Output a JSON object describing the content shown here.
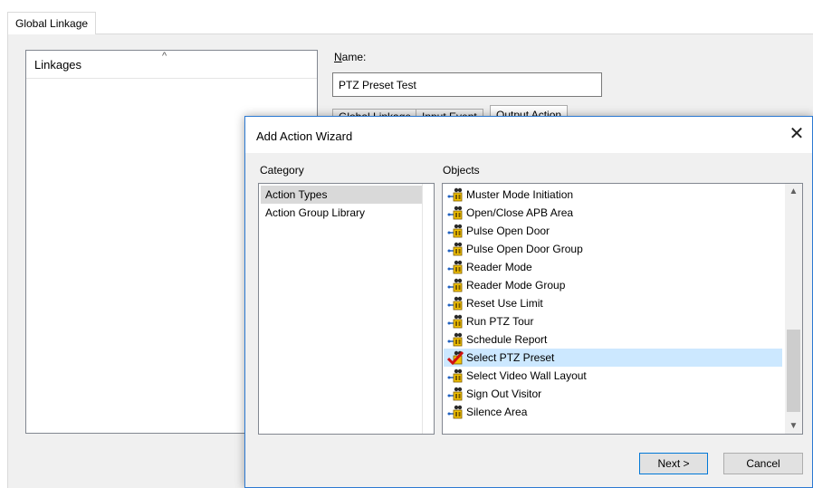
{
  "window": {
    "tab_label": "Global Linkage",
    "linkages_header": "Linkages",
    "sort_arrow": "^",
    "name_label_mnemonic": "N",
    "name_label_rest": "ame:",
    "name_value": "PTZ Preset Test",
    "inner_tabs": [
      "Global Linkage",
      "Input Event",
      "Output Action"
    ]
  },
  "dialog": {
    "title": "Add Action Wizard",
    "close_glyph": "✕",
    "category_label": "Category",
    "objects_label": "Objects",
    "categories": [
      {
        "label": "Action Types",
        "selected": true
      },
      {
        "label": "Action Group Library",
        "selected": false
      }
    ],
    "objects": [
      {
        "label": "Muster Mode Initiation",
        "icon": "action-icon",
        "selected": false
      },
      {
        "label": "Open/Close APB Area",
        "icon": "action-icon",
        "selected": false
      },
      {
        "label": "Pulse Open Door",
        "icon": "action-icon",
        "selected": false
      },
      {
        "label": "Pulse Open Door Group",
        "icon": "action-icon",
        "selected": false
      },
      {
        "label": "Reader Mode",
        "icon": "action-icon",
        "selected": false
      },
      {
        "label": "Reader Mode Group",
        "icon": "action-icon",
        "selected": false
      },
      {
        "label": "Reset Use Limit",
        "icon": "action-icon",
        "selected": false
      },
      {
        "label": "Run PTZ Tour",
        "icon": "action-icon",
        "selected": false
      },
      {
        "label": "Schedule Report",
        "icon": "action-icon",
        "selected": false
      },
      {
        "label": "Select PTZ Preset",
        "icon": "selected-action-icon",
        "selected": true
      },
      {
        "label": "Select Video Wall Layout",
        "icon": "action-icon",
        "selected": false
      },
      {
        "label": "Sign Out Visitor",
        "icon": "action-icon",
        "selected": false
      },
      {
        "label": "Silence Area",
        "icon": "action-icon",
        "selected": false
      }
    ],
    "scroll_up_glyph": "▲",
    "scroll_down_glyph": "▼",
    "next_button": "Next >",
    "cancel_button": "Cancel"
  },
  "colors": {
    "selection_blue": "#cce8ff",
    "dialog_border": "#2b79d2",
    "category_selected": "#d9d9d9"
  }
}
